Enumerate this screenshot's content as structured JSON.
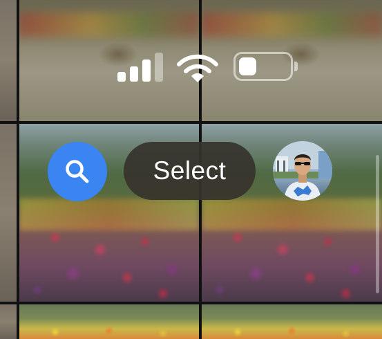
{
  "status_bar": {
    "signal_icon": "cellular-signal-icon",
    "signal_strength_bars": 3,
    "signal_total_bars": 4,
    "wifi_icon": "wifi-icon",
    "battery_icon": "battery-icon",
    "battery_level_fraction": 0.35
  },
  "toolbar": {
    "search_icon": "search-icon",
    "select_label": "Select",
    "avatar_icon": "user-avatar"
  },
  "colors": {
    "search_button": "#3a85f2",
    "select_button_bg": "#37342d",
    "status_icons": "#ffffff"
  }
}
